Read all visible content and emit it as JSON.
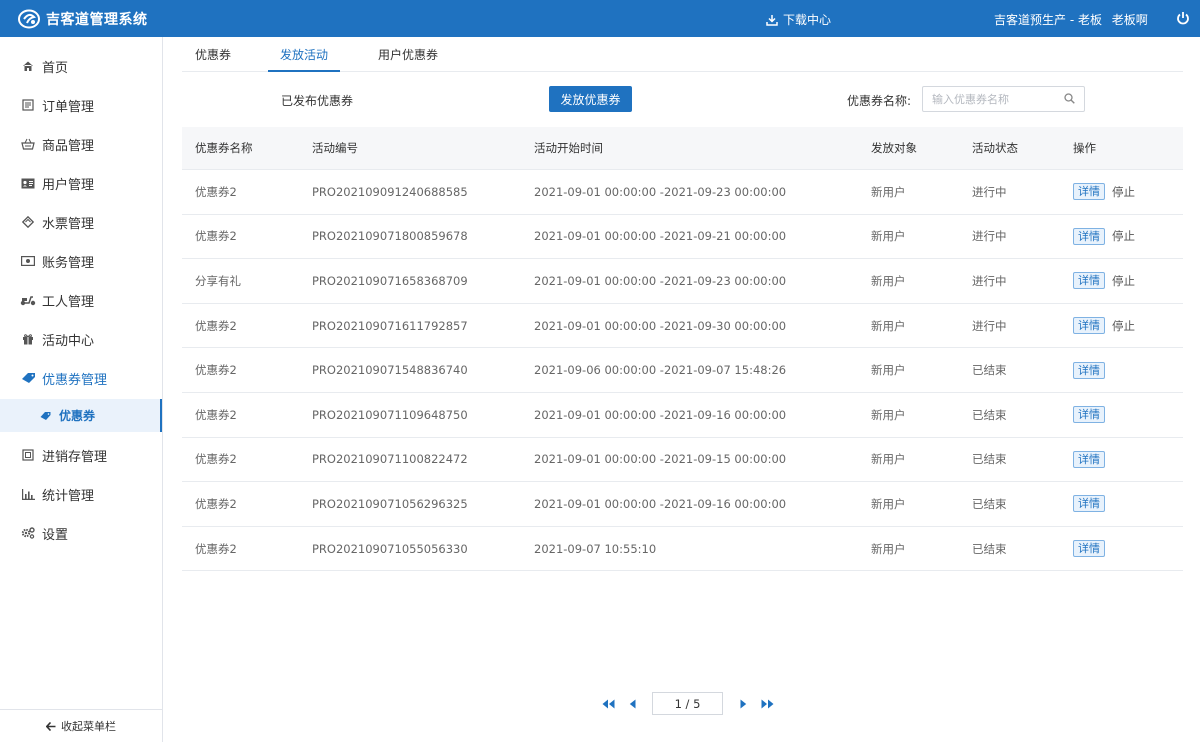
{
  "header": {
    "app_title": "吉客道管理系统",
    "download_label": "下载中心",
    "org": "吉客道预生产 - 老板",
    "username": "老板啊"
  },
  "sidebar": {
    "items": [
      {
        "label": "首页",
        "icon": "home-icon"
      },
      {
        "label": "订单管理",
        "icon": "order-icon"
      },
      {
        "label": "商品管理",
        "icon": "basket-icon"
      },
      {
        "label": "用户管理",
        "icon": "id-card-icon"
      },
      {
        "label": "水票管理",
        "icon": "ticket-icon"
      },
      {
        "label": "账务管理",
        "icon": "money-icon"
      },
      {
        "label": "工人管理",
        "icon": "scooter-icon"
      },
      {
        "label": "活动中心",
        "icon": "gift-icon"
      },
      {
        "label": "优惠券管理",
        "icon": "coupon-icon"
      }
    ],
    "sub_item": {
      "label": "优惠券",
      "icon": "coupon-small-icon"
    },
    "items_after": [
      {
        "label": "进销存管理",
        "icon": "inventory-icon"
      },
      {
        "label": "统计管理",
        "icon": "bar-chart-icon"
      },
      {
        "label": "设置",
        "icon": "gear-icon"
      }
    ],
    "collapse_label": "收起菜单栏"
  },
  "tabs": [
    {
      "label": "优惠券"
    },
    {
      "label": "发放活动",
      "active": true
    },
    {
      "label": "用户优惠券"
    }
  ],
  "toolbar": {
    "published_label": "已发布优惠券",
    "issue_button": "发放优惠券",
    "search_label": "优惠券名称:",
    "search_placeholder": "输入优惠券名称"
  },
  "table": {
    "columns": [
      "优惠券名称",
      "活动编号",
      "活动开始时间",
      "发放对象",
      "活动状态",
      "操作"
    ],
    "rows": [
      {
        "name": "优惠券2",
        "code": "PRO202109091240688585",
        "time": "2021-09-01 00:00:00 -2021-09-23 00:00:00",
        "target": "新用户",
        "status": "进行中",
        "actions": [
          "详情",
          "停止"
        ]
      },
      {
        "name": "优惠券2",
        "code": "PRO202109071800859678",
        "time": "2021-09-01 00:00:00 -2021-09-21 00:00:00",
        "target": "新用户",
        "status": "进行中",
        "actions": [
          "详情",
          "停止"
        ]
      },
      {
        "name": "分享有礼",
        "code": "PRO202109071658368709",
        "time": "2021-09-01 00:00:00 -2021-09-23 00:00:00",
        "target": "新用户",
        "status": "进行中",
        "actions": [
          "详情",
          "停止"
        ]
      },
      {
        "name": "优惠券2",
        "code": "PRO202109071611792857",
        "time": "2021-09-01 00:00:00 -2021-09-30 00:00:00",
        "target": "新用户",
        "status": "进行中",
        "actions": [
          "详情",
          "停止"
        ]
      },
      {
        "name": "优惠券2",
        "code": "PRO202109071548836740",
        "time": "2021-09-06 00:00:00 -2021-09-07 15:48:26",
        "target": "新用户",
        "status": "已结束",
        "actions": [
          "详情"
        ]
      },
      {
        "name": "优惠券2",
        "code": "PRO202109071109648750",
        "time": "2021-09-01 00:00:00 -2021-09-16 00:00:00",
        "target": "新用户",
        "status": "已结束",
        "actions": [
          "详情"
        ]
      },
      {
        "name": "优惠券2",
        "code": "PRO202109071100822472",
        "time": "2021-09-01 00:00:00 -2021-09-15 00:00:00",
        "target": "新用户",
        "status": "已结束",
        "actions": [
          "详情"
        ]
      },
      {
        "name": "优惠券2",
        "code": "PRO202109071056296325",
        "time": "2021-09-01 00:00:00 -2021-09-16 00:00:00",
        "target": "新用户",
        "status": "已结束",
        "actions": [
          "详情"
        ]
      },
      {
        "name": "优惠券2",
        "code": "PRO202109071055056330",
        "time": "2021-09-07 10:55:10",
        "target": "新用户",
        "status": "已结束",
        "actions": [
          "详情"
        ]
      }
    ]
  },
  "pager": {
    "page_text": "1 / 5"
  },
  "colors": {
    "primary": "#1f72c0",
    "header_bg": "#1f72c0",
    "active_sub_bg": "#eaf2fb"
  }
}
